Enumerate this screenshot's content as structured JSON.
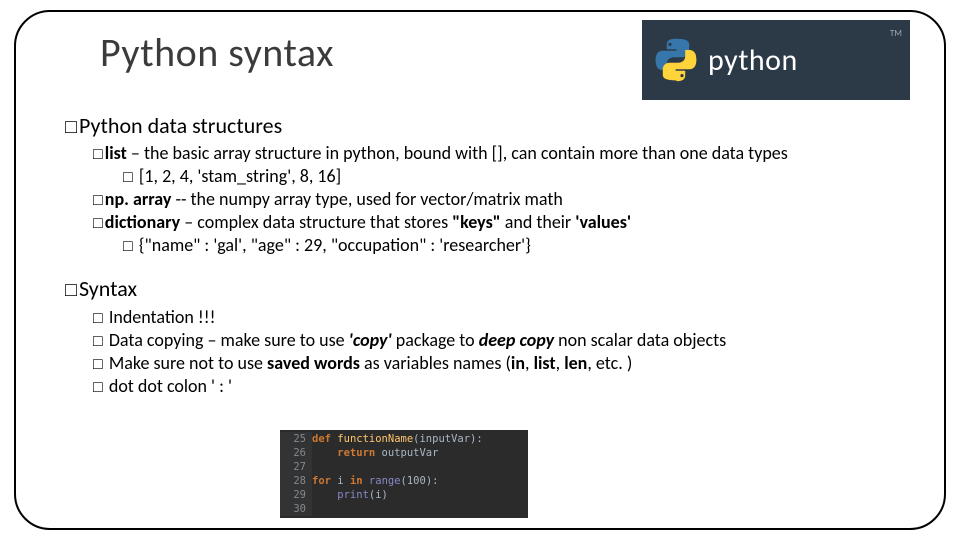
{
  "title": "Python syntax",
  "logo": {
    "text": "python",
    "tm": "TM"
  },
  "section1": {
    "heading": "Python data structures",
    "list": {
      "term": "list",
      "desc": "the basic array structure in python, bound with [], can contain more than one data types",
      "example": "[1, 2, 4, 'stam_string', 8, 16]"
    },
    "nparray": {
      "term": "np. array",
      "desc": "-- the numpy array type, used for vector/matrix  math"
    },
    "dict": {
      "term": "dictionary",
      "desc_pre": "complex data structure that stores ",
      "keys": "\"keys\"",
      "mid": " and their ",
      "values": "'values'",
      "example": "{\"name\" :  'gal', \"age\" : 29, \"occupation\" : 'researcher'}"
    }
  },
  "section2": {
    "heading": "Syntax",
    "indent": "Indentation !!!",
    "copy": {
      "pre": "Data copying – make sure to use ",
      "pkg": "'copy'",
      "mid1": " package to ",
      "deep": "deep copy",
      "post": " non scalar data objects"
    },
    "saved": {
      "pre": "Make sure not to use ",
      "sw": "saved words",
      "mid": " as variables names (",
      "in": "in",
      "c1": ", ",
      "list": "list",
      "c2": ", ",
      "len": "len",
      "post": ", etc. )"
    },
    "colon": "dot dot colon  ' : '"
  },
  "code": {
    "l25": "25",
    "l26": "26",
    "l27": "27",
    "l28": "28",
    "l29": "29",
    "l30": "30",
    "def": "def ",
    "fname": "functionName",
    "args": "(inputVar):",
    "ret": "    return ",
    "retv": "outputVar",
    "for": "for ",
    "ivar": "i ",
    "in": "in ",
    "range": "range",
    "rargs": "(100):",
    "print": "    print",
    "pargs": "(i)"
  }
}
